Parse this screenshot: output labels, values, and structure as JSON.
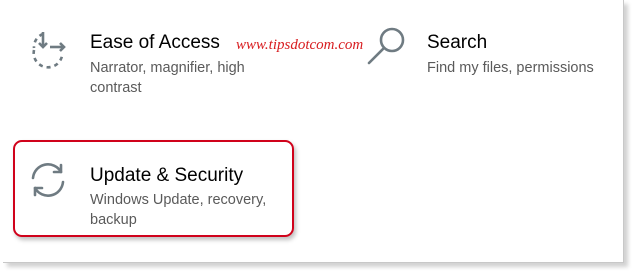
{
  "tiles": {
    "ease_of_access": {
      "title": "Ease of Access",
      "description_line1": "Narrator, magnifier, high",
      "description_line2": "contrast",
      "icon": "ease-of-access-icon"
    },
    "search": {
      "title": "Search",
      "description_line1": "Find my files, permissions",
      "icon": "search-icon"
    },
    "update_security": {
      "title": "Update & Security",
      "description_line1": "Windows Update, recovery,",
      "description_line2": "backup",
      "icon": "sync-icon"
    }
  },
  "watermark": "www.tipsdotcom.com",
  "colors": {
    "icon": "#6f7b82",
    "highlight": "#d0021b",
    "watermark": "#d81d20",
    "description": "#5a5a5a"
  }
}
